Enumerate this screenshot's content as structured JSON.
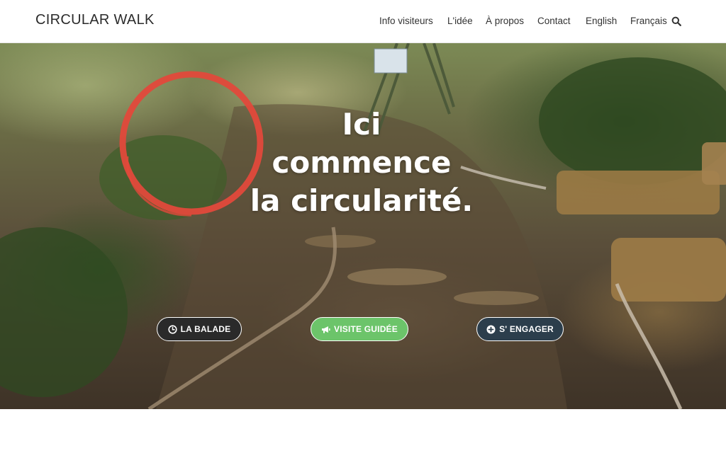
{
  "header": {
    "logo": "CIRCULAR WALK",
    "nav": [
      {
        "label": "Info visiteurs"
      },
      {
        "label": "L'idée"
      },
      {
        "label": "À propos"
      },
      {
        "label": "Contact"
      },
      {
        "label": "English"
      },
      {
        "label": "Français"
      }
    ],
    "search_icon": "search-icon"
  },
  "hero": {
    "title_lines": [
      "Ici",
      "commence",
      "la circularité."
    ],
    "buttons": [
      {
        "label": "LA BALADE",
        "icon": "clock-icon",
        "color": "#2a2a2a"
      },
      {
        "label": "VISITE GUIDÉE",
        "icon": "megaphone-icon",
        "color": "#6cc46a"
      },
      {
        "label": "S' ENGAGER",
        "icon": "plus-circle-icon",
        "color": "#2c3e4c"
      }
    ],
    "accent_circle_color": "#e2493b"
  }
}
